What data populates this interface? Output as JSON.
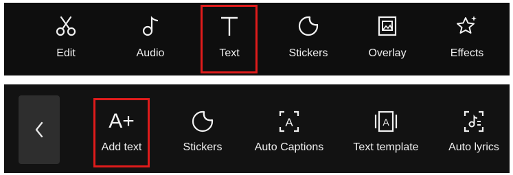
{
  "top_bar": {
    "items": [
      {
        "label": "Edit",
        "icon": "scissors-icon"
      },
      {
        "label": "Audio",
        "icon": "music-note-icon"
      },
      {
        "label": "Text",
        "icon": "text-t-icon",
        "highlighted": true
      },
      {
        "label": "Stickers",
        "icon": "sticker-icon"
      },
      {
        "label": "Overlay",
        "icon": "overlay-icon"
      },
      {
        "label": "Effects",
        "icon": "star-sparkle-icon"
      }
    ]
  },
  "bottom_bar": {
    "back_icon": "chevron-left-icon",
    "items": [
      {
        "label": "Add text",
        "icon": "add-text-icon",
        "icon_text": "A+",
        "highlighted": true
      },
      {
        "label": "Stickers",
        "icon": "sticker-icon"
      },
      {
        "label": "Auto Captions",
        "icon": "auto-captions-icon"
      },
      {
        "label": "Text template",
        "icon": "text-template-icon"
      },
      {
        "label": "Auto lyrics",
        "icon": "auto-lyrics-icon"
      }
    ]
  },
  "colors": {
    "bar_background": "#0e0e0e",
    "highlight": "#e01b1b",
    "text": "#efefef"
  }
}
